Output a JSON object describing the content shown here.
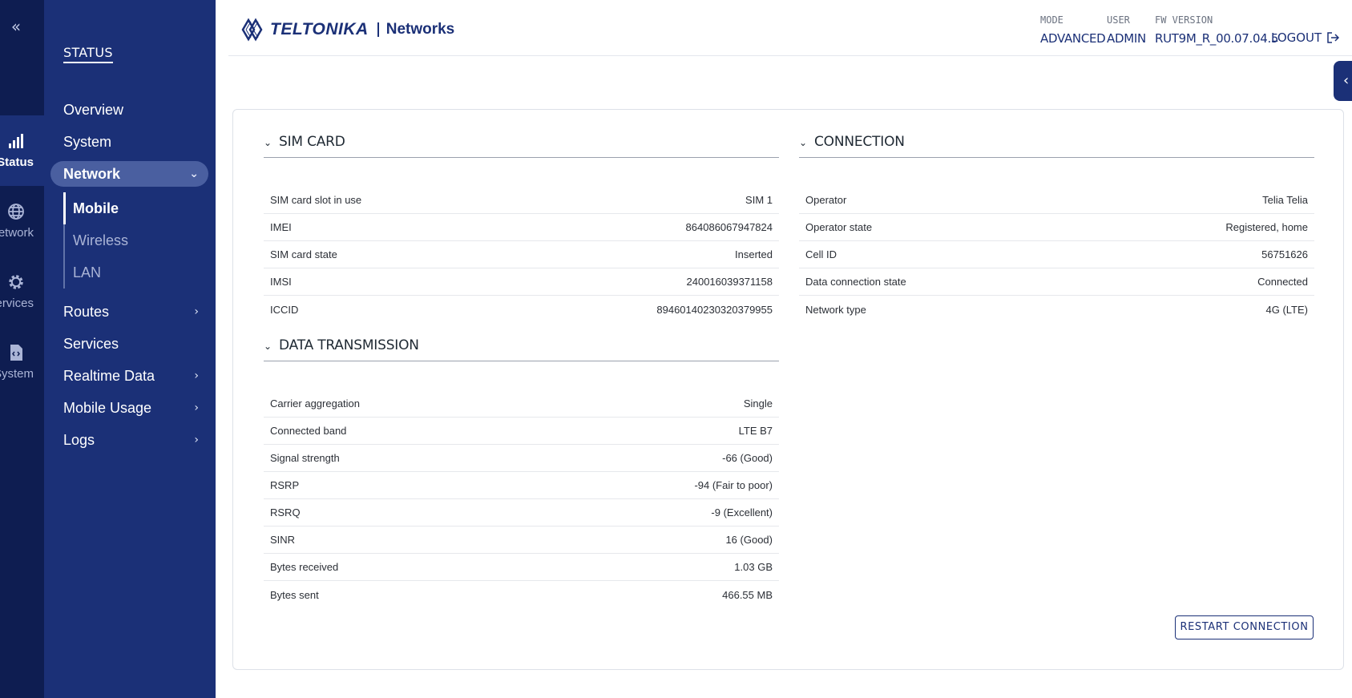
{
  "rail": {
    "collapse_icon": "double-chevron-left-icon",
    "items": [
      {
        "label": "Status",
        "icon": "signal-bars-icon",
        "active": true
      },
      {
        "label": "Network",
        "icon": "globe-icon",
        "active": false
      },
      {
        "label": "Services",
        "icon": "gear-icon",
        "active": false
      },
      {
        "label": "System",
        "icon": "document-code-icon",
        "active": false
      }
    ]
  },
  "nav": {
    "heading": "STATUS",
    "items": [
      {
        "label": "Overview"
      },
      {
        "label": "System"
      },
      {
        "label": "Network"
      },
      {
        "label": "Routes"
      },
      {
        "label": "Services"
      },
      {
        "label": "Realtime Data"
      },
      {
        "label": "Mobile Usage"
      },
      {
        "label": "Logs"
      }
    ],
    "subitems": [
      {
        "label": "Mobile",
        "active": true
      },
      {
        "label": "Wireless",
        "active": false
      },
      {
        "label": "LAN",
        "active": false
      }
    ]
  },
  "header": {
    "logo_text": "TELTONIKA",
    "logo_suffix": "Networks",
    "mode_label": "MODE",
    "mode_value": "ADVANCED",
    "user_label": "USER",
    "user_value": "ADMIN",
    "fw_label": "FW VERSION",
    "fw_value": "RUT9M_R_00.07.04.5",
    "logout_label": "LOGOUT"
  },
  "sim_card": {
    "title": "SIM CARD",
    "rows": [
      {
        "label": "SIM card slot in use",
        "value": "SIM 1"
      },
      {
        "label": "IMEI",
        "value": "864086067947824"
      },
      {
        "label": "SIM card state",
        "value": "Inserted"
      },
      {
        "label": "IMSI",
        "value": "240016039371158"
      },
      {
        "label": "ICCID",
        "value": "89460140230320379955"
      }
    ]
  },
  "data_transmission": {
    "title": "DATA TRANSMISSION",
    "rows": [
      {
        "label": "Carrier aggregation",
        "value": "Single"
      },
      {
        "label": "Connected band",
        "value": "LTE B7"
      },
      {
        "label": "Signal strength",
        "value": "-66 (Good)"
      },
      {
        "label": "RSRP",
        "value": "-94 (Fair to poor)"
      },
      {
        "label": "RSRQ",
        "value": "-9 (Excellent)"
      },
      {
        "label": "SINR",
        "value": "16 (Good)"
      },
      {
        "label": "Bytes received",
        "value": "1.03 GB"
      },
      {
        "label": "Bytes sent",
        "value": "466.55 MB"
      }
    ]
  },
  "connection": {
    "title": "CONNECTION",
    "rows": [
      {
        "label": "Operator",
        "value": "Telia Telia"
      },
      {
        "label": "Operator state",
        "value": "Registered, home"
      },
      {
        "label": "Cell ID",
        "value": "56751626"
      },
      {
        "label": "Data connection state",
        "value": "Connected"
      },
      {
        "label": "Network type",
        "value": "4G (LTE)"
      }
    ]
  },
  "actions": {
    "restart_label": "RESTART CONNECTION"
  },
  "colors": {
    "rail_bg": "#0e1d51",
    "nav_bg": "#1b3077",
    "accent": "#1b3077"
  }
}
